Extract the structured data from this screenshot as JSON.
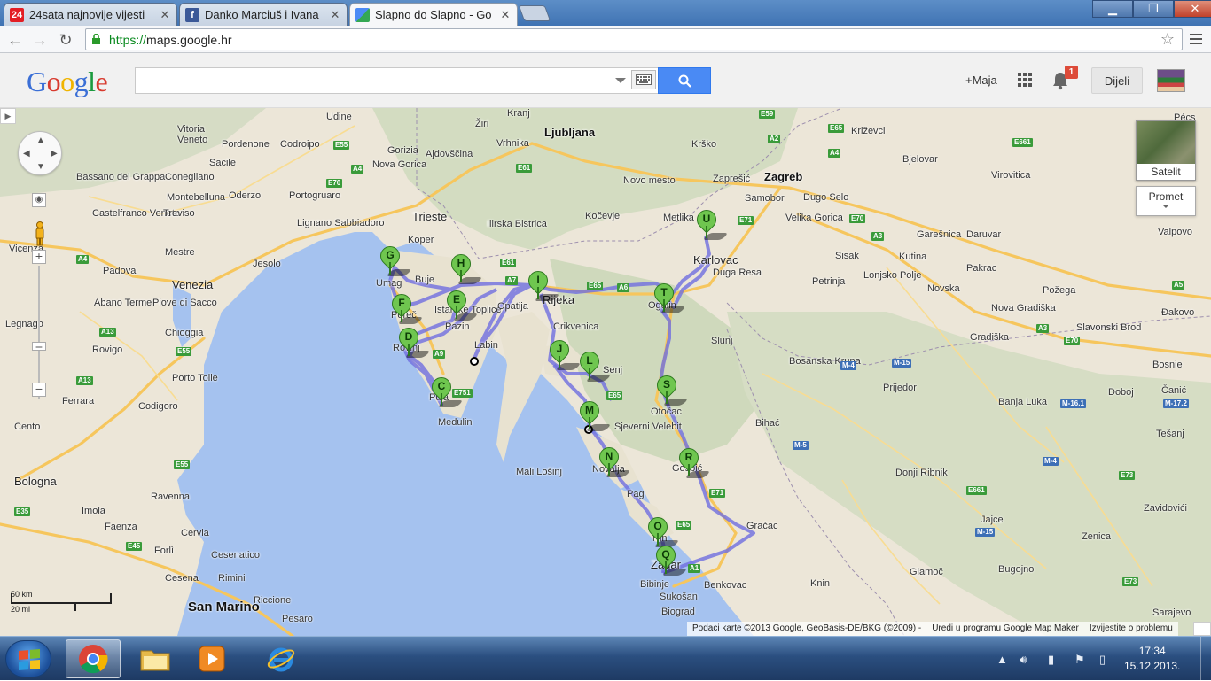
{
  "browser": {
    "tabs": [
      {
        "title": "24sata najnovije vijesti",
        "favicon": "24sata-icon",
        "active": false
      },
      {
        "title": "Danko Marciuš i Ivana",
        "favicon": "facebook-icon",
        "active": false
      },
      {
        "title": "Slapno do Slapno - Go",
        "favicon": "google-maps-icon",
        "active": true
      }
    ],
    "url_scheme": "https://",
    "url_host": "maps.google.hr"
  },
  "header": {
    "logo_letters": [
      "G",
      "o",
      "o",
      "g",
      "l",
      "e"
    ],
    "search_value": "",
    "user_link": "+Maja",
    "notification_count": "1",
    "share_label": "Dijeli"
  },
  "map": {
    "satellite_label": "Satelit",
    "traffic_label": "Promet",
    "scale_km": "50 km",
    "scale_mi": "20 mi",
    "attribution": "Podaci karte ©2013 Google, GeoBasis-DE/BKG (©2009) -",
    "terms_link": "Uredi u programu Google Map Maker",
    "report_link": "Izvijestite o problemu",
    "markers": [
      "C",
      "D",
      "E",
      "F",
      "G",
      "H",
      "I",
      "J",
      "L",
      "M",
      "N",
      "O",
      "Q",
      "R",
      "S",
      "T",
      "U"
    ],
    "labels": [
      "Udine",
      "Vitoria",
      "Veneto",
      "Pordenone",
      "Codroipo",
      "Gorizia",
      "Nova Gorica",
      "Kranj",
      "Žiri",
      "Vrhnika",
      "Ljubljana",
      "Krško",
      "Sacile",
      "Ajdovščina",
      "Novo mesto",
      "Zaprešić",
      "Zagreb",
      "Križevci",
      "Bassano del Grappa",
      "Conegliano",
      "Montebelluna",
      "Oderzo",
      "Portogruaro",
      "Trieste",
      "Koper",
      "Ilirska Bistrica",
      "Kočevje",
      "Metlika",
      "Samobor",
      "Dugo Selo",
      "Bjelovar",
      "Virovitica",
      "Castelfranco Veneto",
      "Treviso",
      "Lignano Sabbiadoro",
      "Jesolo",
      "Vicenza",
      "Padova",
      "Mestre",
      "Venezia",
      "Umag",
      "Buje",
      "Poreč",
      "Rovinj",
      "Pula",
      "Medulin",
      "Labin",
      "Pazin",
      "Istarske Toplice",
      "Opatija",
      "Rijeka",
      "Crikvenica",
      "Senj",
      "Ogulin",
      "Karlovac",
      "Duga Resa",
      "Velika Gorica",
      "Sisak",
      "Kutina",
      "Novska",
      "Garešnica",
      "Daruvar",
      "Pakrac",
      "Požega",
      "Valpovo",
      "Slunj",
      "Otočac",
      "Gospić",
      "Novalja",
      "Pag",
      "Nin",
      "Zadar",
      "Biograd",
      "Bibinje",
      "Sukošan",
      "Benkovac",
      "Knin",
      "Gračac",
      "Mali Lošinj",
      "Sjeverni Velebit",
      "Bihać",
      "Bosanska Krupa",
      "Prijedor",
      "Banja Luka",
      "Doboj",
      "Gradiška",
      "Slavonski Brod",
      "Đakovo",
      "Petrinja",
      "Lonjsko Polje",
      "Nova Gradiška",
      "Abano Terme",
      "Piove di Sacco",
      "Chioggia",
      "Rovigo",
      "Porto Tolle",
      "Ferrara",
      "Codigoro",
      "Cento",
      "Bologna",
      "Imola",
      "Ravenna",
      "Faenza",
      "Cervia",
      "Forlì",
      "Cesenatico",
      "Cesena",
      "Rimini",
      "Riccione",
      "Pesaro",
      "San Marino",
      "Legnago",
      "Čanić",
      "Tešanj",
      "Zavidovići",
      "Zenica",
      "Bugojno",
      "Glamoč",
      "Jajce",
      "Donji Ribnik",
      "Pécs",
      "Bosnie",
      "Sarajevo"
    ]
  }
}
